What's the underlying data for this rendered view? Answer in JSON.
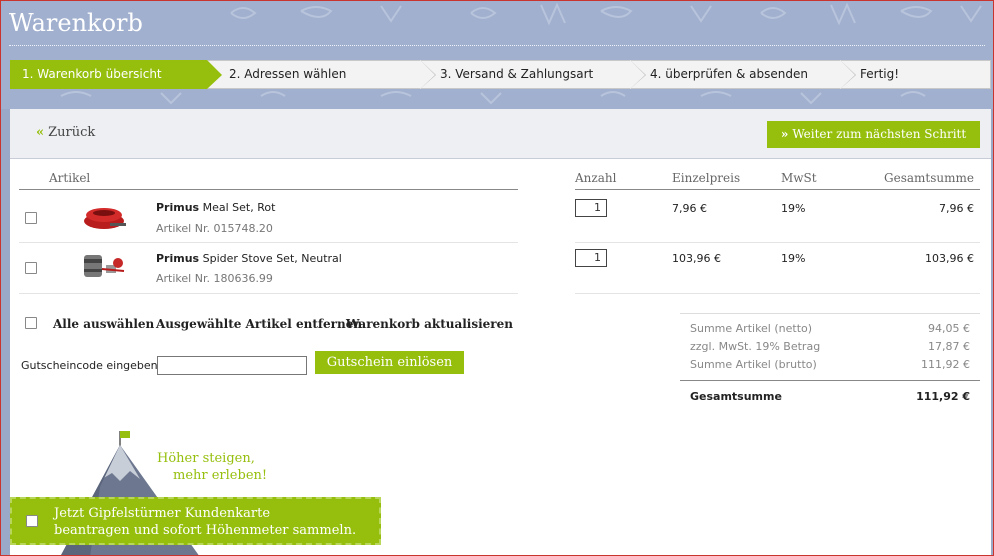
{
  "page": {
    "title": "Warenkorb"
  },
  "steps": [
    {
      "label": "1. Warenkorb übersicht",
      "active": true
    },
    {
      "label": "2. Adressen wählen",
      "active": false
    },
    {
      "label": "3. Versand & Zahlungsart",
      "active": false
    },
    {
      "label": "4. überprüfen & absenden",
      "active": false
    },
    {
      "label": "Fertig!",
      "active": false
    }
  ],
  "nav": {
    "back_label": "Zurück",
    "next_label": "Weiter zum nächsten Schritt",
    "chevron": "»"
  },
  "table": {
    "headers": {
      "article": "Artikel",
      "quantity": "Anzahl",
      "unit_price": "Einzelpreis",
      "tax": "MwSt",
      "total": "Gesamtsumme"
    },
    "items": [
      {
        "brand": "Primus",
        "name": "Meal Set, Rot",
        "article_no": "Artikel Nr. 015748.20",
        "quantity": "1",
        "unit_price": "7,96 €",
        "tax": "19%",
        "total": "7,96 €",
        "image": "red-meal-set"
      },
      {
        "brand": "Primus",
        "name": "Spider Stove Set, Neutral",
        "article_no": "Artikel Nr. 180636.99",
        "quantity": "1",
        "unit_price": "103,96 €",
        "tax": "19%",
        "total": "103,96 €",
        "image": "spider-stove-set"
      }
    ]
  },
  "actions": {
    "select_all": "Alle auswählen",
    "remove_selected": "Ausgewählte Artikel entfernen",
    "update_cart": "Warenkorb aktualisieren"
  },
  "coupon": {
    "label": "Gutscheincode eingeben:",
    "value": "",
    "button": "Gutschein einlösen"
  },
  "summary": {
    "net_label": "Summe Artikel (netto)",
    "net_value": "94,05 €",
    "vat_label": "zzgl. MwSt. 19% Betrag",
    "vat_value": "17,87 €",
    "gross_label": "Summe Artikel (brutto)",
    "gross_value": "111,92 €",
    "total_label": "Gesamtsumme",
    "total_value": "111,92 €"
  },
  "promo": {
    "line1": "Höher steigen,",
    "line2": "mehr erleben!",
    "banner_line1": "Jetzt Gipfelstürmer Kundenkarte",
    "banner_line2": "beantragen und sofort Höhenmeter sammeln."
  },
  "colors": {
    "accent": "#96bf0d",
    "header_bg": "#a1b0cf"
  }
}
